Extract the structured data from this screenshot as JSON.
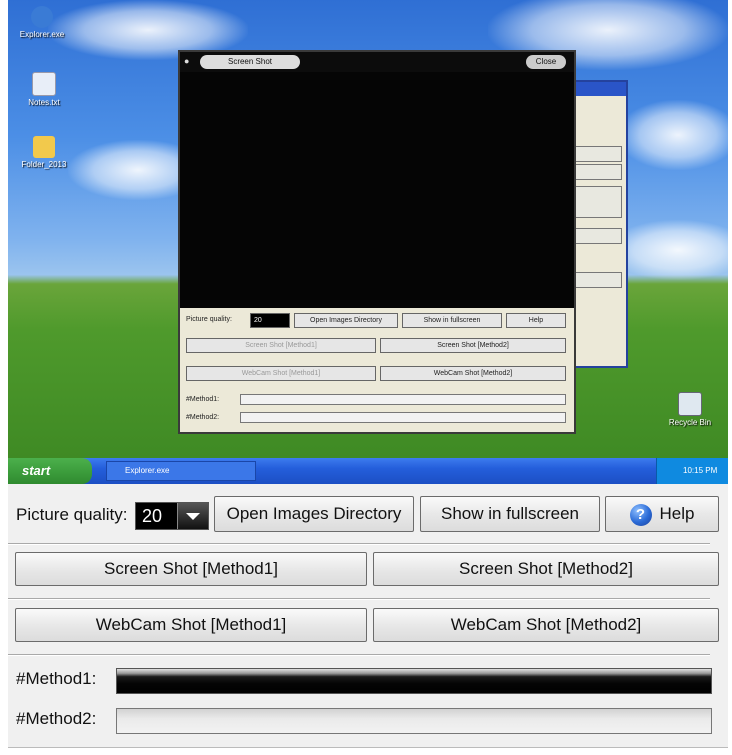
{
  "desktop": {
    "icons": [
      {
        "label": "Explorer.exe",
        "color": "#3a7bd5"
      },
      {
        "label": "Notes.txt",
        "color": "#e8eef8"
      },
      {
        "label": "Folder_2013",
        "color": "#f2c94c"
      }
    ],
    "recycle_bin_label": "Recycle Bin"
  },
  "mini_window": {
    "title": "Screen Shot",
    "close_label": "Close",
    "picture_quality_label": "Picture quality:",
    "quality_value": "20",
    "open_dir_label": "Open Images Directory",
    "fullscreen_label": "Show in fullscreen",
    "help_label": "Help",
    "screen1_label": "Screen Shot [Method1]",
    "screen2_label": "Screen Shot [Method2]",
    "webcam1_label": "WebCam Shot [Method1]",
    "webcam2_label": "WebCam Shot [Method2]",
    "method1_label": "#Method1:",
    "method2_label": "#Method2:"
  },
  "taskbar": {
    "start_label": "start",
    "task_item_label": "Explorer.exe",
    "clock": "10:15 PM"
  },
  "panel": {
    "picture_quality_label": "Picture quality:",
    "quality_value": "20",
    "open_dir_label": "Open Images Directory",
    "fullscreen_label": "Show in fullscreen",
    "help_label": "Help",
    "screen1_label": "Screen Shot [Method1]",
    "screen2_label": "Screen Shot [Method2]",
    "webcam1_label": "WebCam Shot [Method1]",
    "webcam2_label": "WebCam Shot [Method2]",
    "method1_label": "#Method1:",
    "method2_label": "#Method2:",
    "method1_progress": 1.0,
    "method2_progress": 0.0
  },
  "colors": {
    "taskbar_blue": "#245edb",
    "start_green": "#3a9a3a",
    "panel_bg": "#f0f0f0"
  }
}
